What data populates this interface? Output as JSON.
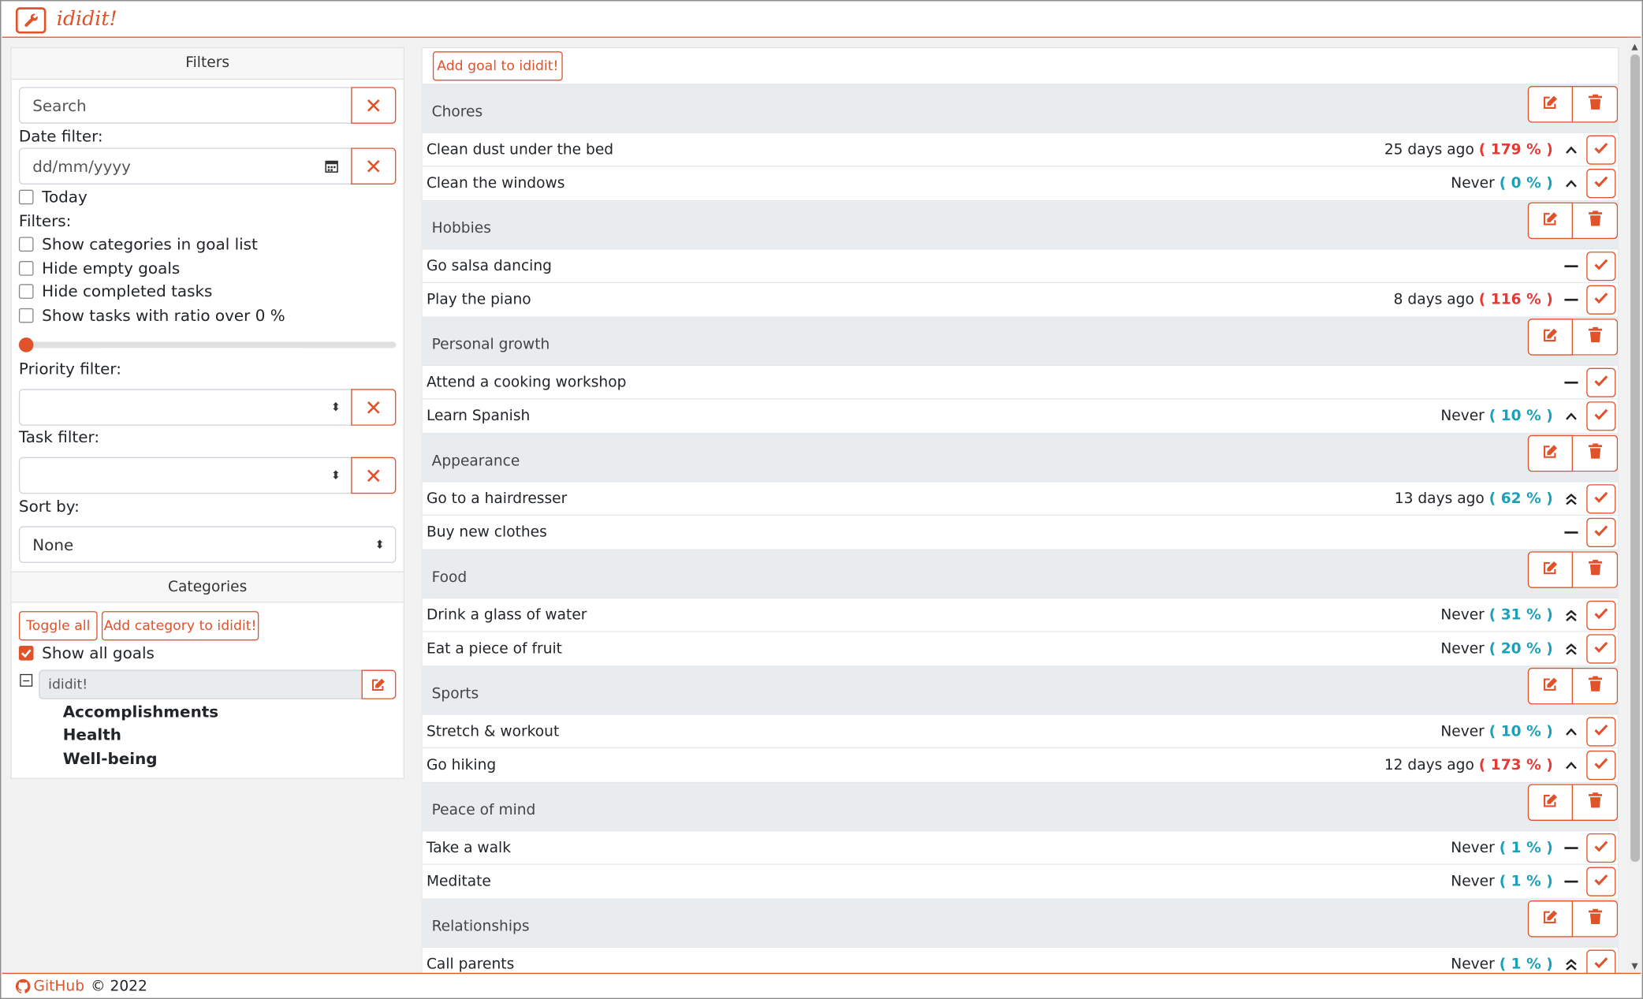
{
  "app": {
    "title": "ididit!",
    "accent": "#e0522a"
  },
  "filters": {
    "heading": "Filters",
    "search_placeholder": "Search",
    "date_label": "Date filter:",
    "date_placeholder": "dd/mm/yyyy",
    "today": "Today",
    "filters_label": "Filters:",
    "checks": [
      "Show categories in goal list",
      "Hide empty goals",
      "Hide completed tasks",
      "Show tasks with ratio over 0 %"
    ],
    "slider_value_percent": 0,
    "priority_label": "Priority filter:",
    "task_label": "Task filter:",
    "sort_label": "Sort by:",
    "sort_value": "None"
  },
  "categories": {
    "heading": "Categories",
    "toggle_all": "Toggle all",
    "add_category": "Add category to ididit!",
    "show_all": "Show all goals",
    "root": "ididit!",
    "children": [
      "Accomplishments",
      "Health",
      "Well-being"
    ]
  },
  "main": {
    "add_goal": "Add goal to ididit!",
    "goals": [
      {
        "name": "Chores",
        "tasks": [
          {
            "name": "Clean dust under the bed",
            "status": "25 days ago",
            "ratio": "( 179 % )",
            "ratio_color": "red",
            "priority": "up"
          },
          {
            "name": "Clean the windows",
            "status": "Never",
            "ratio": "( 0 % )",
            "ratio_color": "blue",
            "priority": "up"
          }
        ]
      },
      {
        "name": "Hobbies",
        "tasks": [
          {
            "name": "Go salsa dancing",
            "status": "",
            "ratio": "",
            "ratio_color": "",
            "priority": "dash"
          },
          {
            "name": "Play the piano",
            "status": "8 days ago",
            "ratio": "( 116 % )",
            "ratio_color": "red",
            "priority": "dash"
          }
        ]
      },
      {
        "name": "Personal growth",
        "tasks": [
          {
            "name": "Attend a cooking workshop",
            "status": "",
            "ratio": "",
            "ratio_color": "",
            "priority": "dash"
          },
          {
            "name": "Learn Spanish",
            "status": "Never",
            "ratio": "( 10 % )",
            "ratio_color": "blue",
            "priority": "up"
          }
        ]
      },
      {
        "name": "Appearance",
        "tasks": [
          {
            "name": "Go to a hairdresser",
            "status": "13 days ago",
            "ratio": "( 62 % )",
            "ratio_color": "blue",
            "priority": "double-up"
          },
          {
            "name": "Buy new clothes",
            "status": "",
            "ratio": "",
            "ratio_color": "",
            "priority": "dash"
          }
        ]
      },
      {
        "name": "Food",
        "tasks": [
          {
            "name": "Drink a glass of water",
            "status": "Never",
            "ratio": "( 31 % )",
            "ratio_color": "blue",
            "priority": "double-up"
          },
          {
            "name": "Eat a piece of fruit",
            "status": "Never",
            "ratio": "( 20 % )",
            "ratio_color": "blue",
            "priority": "double-up"
          }
        ]
      },
      {
        "name": "Sports",
        "tasks": [
          {
            "name": "Stretch & workout",
            "status": "Never",
            "ratio": "( 10 % )",
            "ratio_color": "blue",
            "priority": "up"
          },
          {
            "name": "Go hiking",
            "status": "12 days ago",
            "ratio": "( 173 % )",
            "ratio_color": "red",
            "priority": "up"
          }
        ]
      },
      {
        "name": "Peace of mind",
        "tasks": [
          {
            "name": "Take a walk",
            "status": "Never",
            "ratio": "( 1 % )",
            "ratio_color": "blue",
            "priority": "dash"
          },
          {
            "name": "Meditate",
            "status": "Never",
            "ratio": "( 1 % )",
            "ratio_color": "blue",
            "priority": "dash"
          }
        ]
      },
      {
        "name": "Relationships",
        "tasks": [
          {
            "name": "Call parents",
            "status": "Never",
            "ratio": "( 1 % )",
            "ratio_color": "blue",
            "priority": "double-up"
          }
        ]
      }
    ]
  },
  "footer": {
    "github": "GitHub",
    "copyright": "© 2022"
  }
}
